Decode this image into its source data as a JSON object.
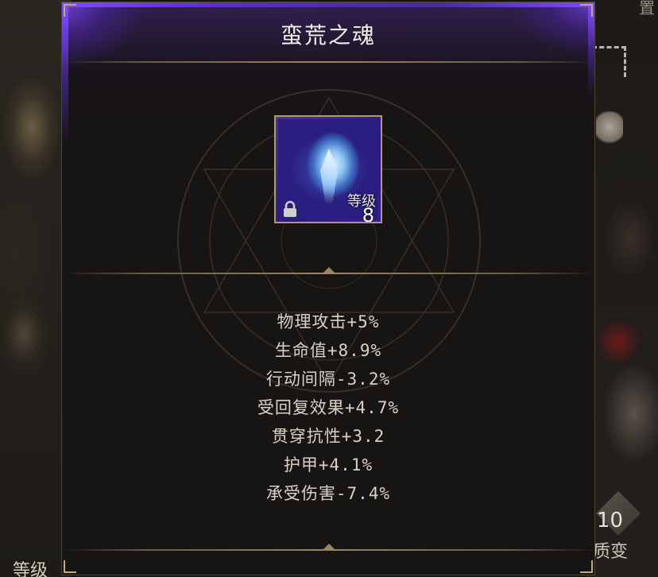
{
  "background": {
    "top_right_text": "置",
    "bottom_left_label": "等级",
    "right_number": "10",
    "right_label": "质变"
  },
  "dialog": {
    "title": "蛮荒之魂",
    "item": {
      "icon": "demon-blade-icon",
      "level_label": "等级",
      "level_value": "8",
      "locked": true
    },
    "stats": [
      "物理攻击+5%",
      "生命值+8.9%",
      "行动间隔-3.2%",
      "受回复效果+4.7%",
      "贯穿抗性+3.2",
      "护甲+4.1%",
      "承受伤害-7.4%"
    ]
  },
  "colors": {
    "rarity_purple": "#7d4bff",
    "frame_gold": "#b39a6c",
    "stat_text": "#d9d2c4"
  }
}
